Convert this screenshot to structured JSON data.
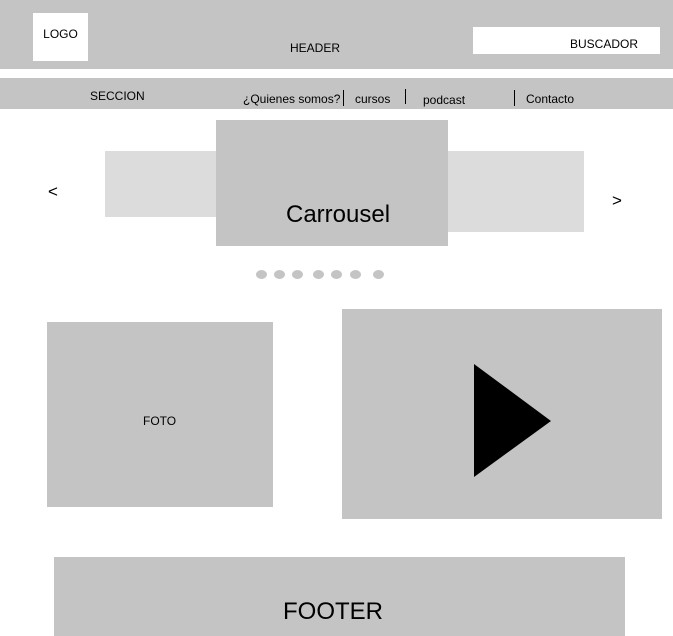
{
  "header": {
    "logo": "LOGO",
    "label": "HEADER",
    "search_label": "BUSCADOR"
  },
  "nav": {
    "section": "SECCION",
    "items": [
      {
        "label": "¿Quienes somos?"
      },
      {
        "label": "cursos"
      },
      {
        "label": "podcast"
      },
      {
        "label": "Contacto"
      }
    ]
  },
  "carousel": {
    "title": "Carrousel",
    "prev": "<",
    "next": ">",
    "dot_count": 7
  },
  "content": {
    "photo_label": "FOTO",
    "video_icon": "play-icon"
  },
  "footer": {
    "label": "FOOTER"
  },
  "colors": {
    "block": "#c4c4c4",
    "block_light": "#dcdcdc",
    "background": "#ffffff"
  }
}
